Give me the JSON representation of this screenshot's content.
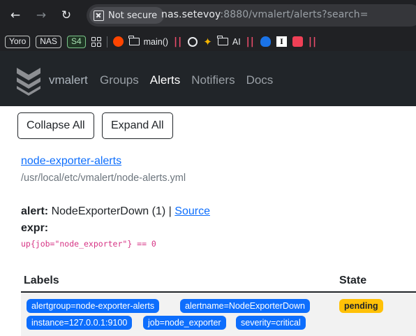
{
  "browser": {
    "security_label": "Not secure",
    "url_host": "nas.setevoy",
    "url_rest": ":8880/vmalert/alerts?search=",
    "bookmarks": {
      "yoro": "Yoro",
      "nas": "NAS",
      "s4": "S4",
      "main": "main()",
      "ai": "AI",
      "pipes": "||",
      "instapaper": "I"
    }
  },
  "app": {
    "brand": "vmalert",
    "nav": [
      "Groups",
      "Alerts",
      "Notifiers",
      "Docs"
    ],
    "active_nav": "Alerts"
  },
  "controls": {
    "collapse_all": "Collapse All",
    "expand_all": "Expand All"
  },
  "group": {
    "name": "node-exporter-alerts",
    "file": "/usr/local/etc/vmalert/node-alerts.yml"
  },
  "alert": {
    "alert_label": "alert:",
    "name_text": "NodeExporterDown (1) |",
    "source_link": "Source",
    "expr_label": "expr:",
    "expr": "up{job=\"node_exporter\"} == 0"
  },
  "table": {
    "headers": {
      "labels": "Labels",
      "state": "State"
    },
    "rows": [
      {
        "labels": [
          "alertgroup=node-exporter-alerts",
          "alertname=NodeExporterDown",
          "instance=127.0.0.1:9100",
          "job=node_exporter",
          "severity=critical"
        ],
        "state": "pending"
      }
    ]
  },
  "colors": {
    "header_bg": "#212529",
    "link": "#0d6efd",
    "badge": "#0d6efd",
    "pending": "#ffc107",
    "code": "#d63384"
  }
}
